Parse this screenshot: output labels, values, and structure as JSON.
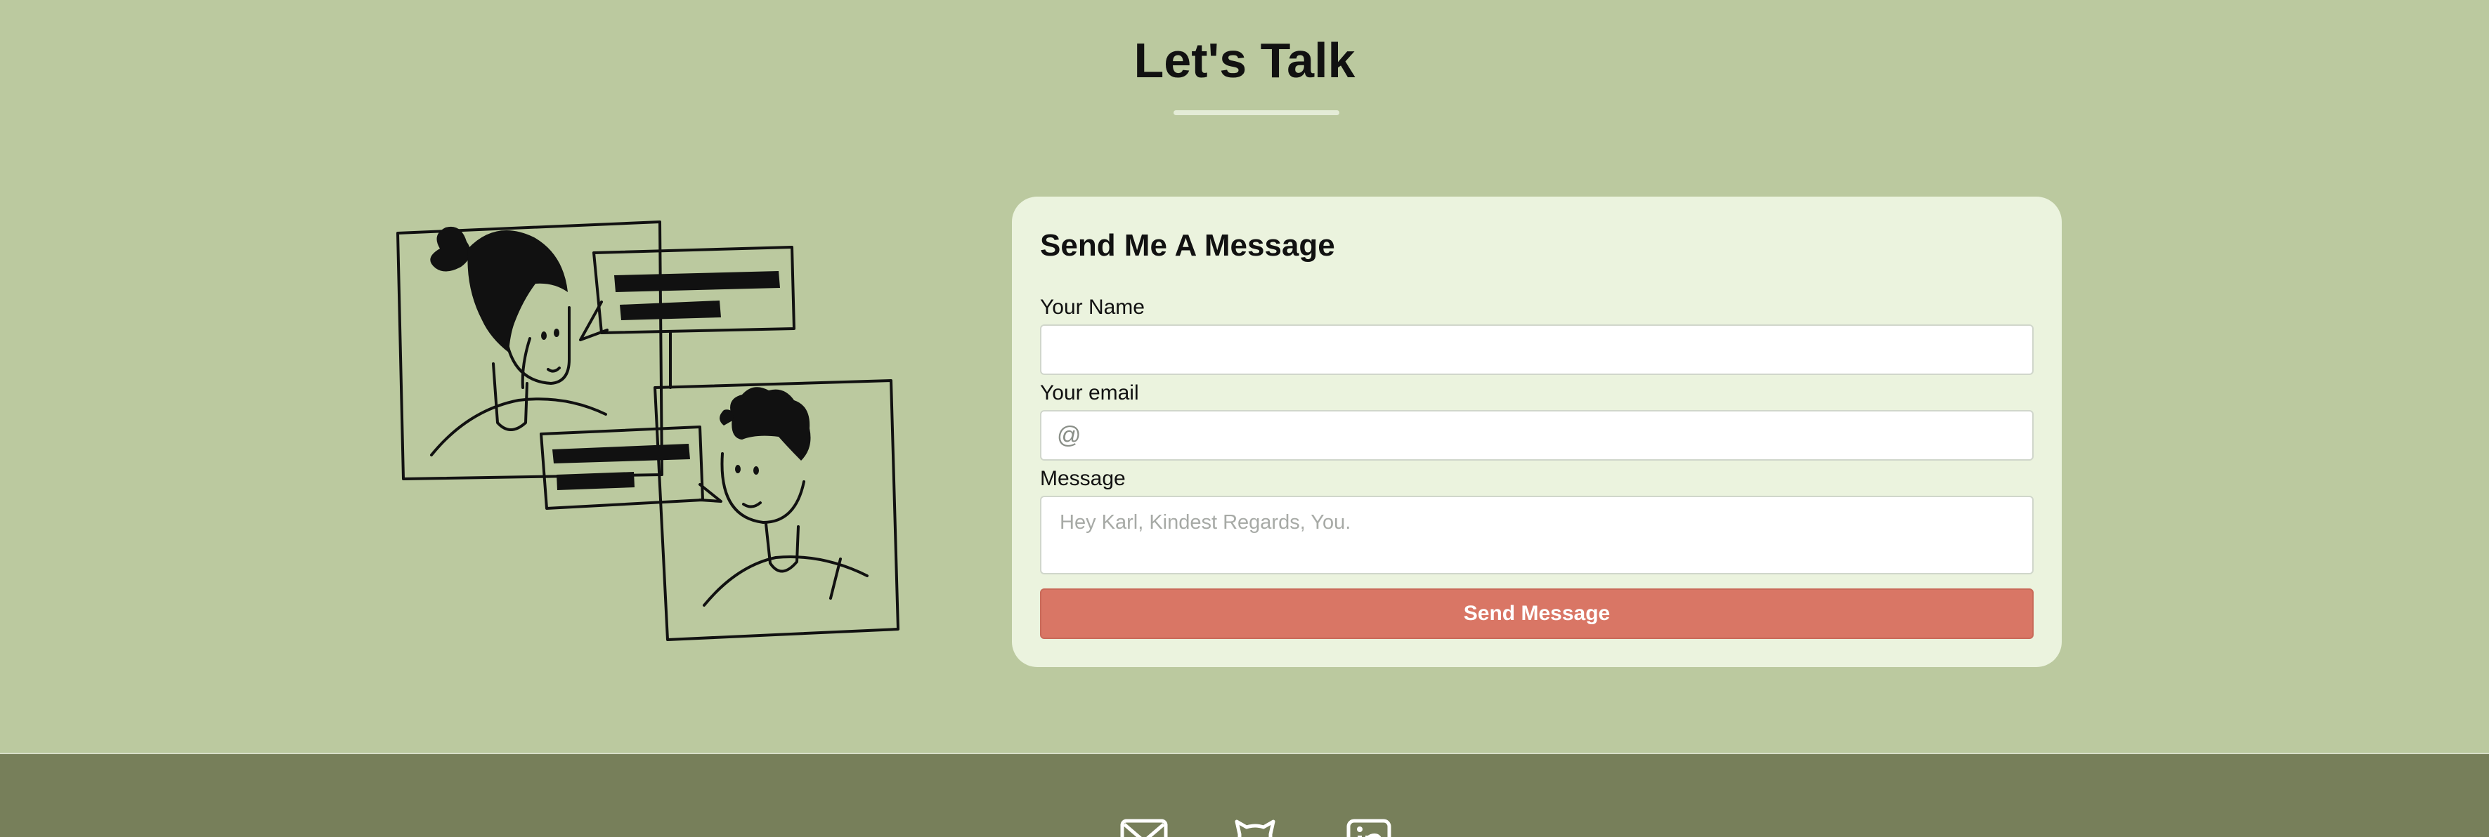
{
  "header": {
    "title": "Let's Talk"
  },
  "illustration": {
    "icon": "chat-people-illustration"
  },
  "form": {
    "heading": "Send Me A Message",
    "name_label": "Your Name",
    "name_value": "",
    "email_label": "Your email",
    "email_icon": "@",
    "email_value": "",
    "message_label": "Message",
    "message_placeholder": "Hey Karl, Kindest Regards, You.",
    "submit_label": "Send Message"
  },
  "footer": {
    "icons": [
      "mail-icon",
      "github-icon",
      "linkedin-icon"
    ]
  },
  "colors": {
    "background": "#bbc99f",
    "card": "#ebf3de",
    "button": "#d97665",
    "footer": "#777f5a",
    "title_underline": "#e4ecd7"
  }
}
